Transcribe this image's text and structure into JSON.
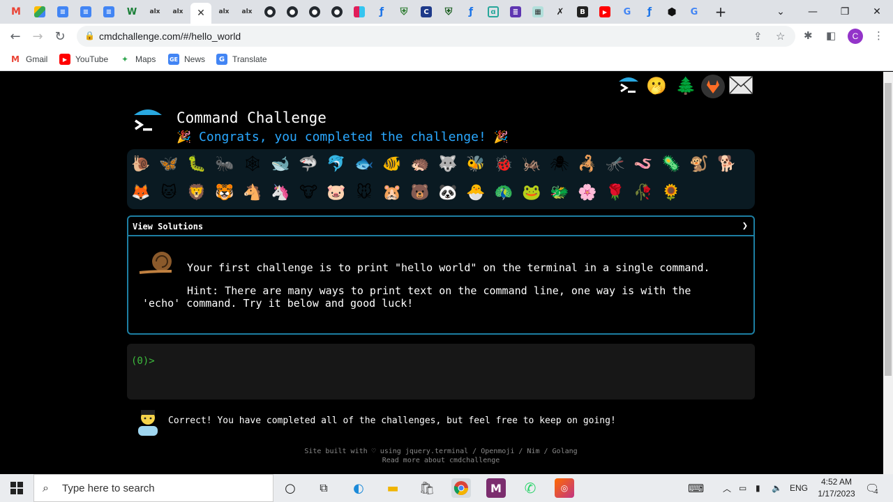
{
  "browser": {
    "tabs_favicons": [
      "gmail-icon",
      "drive-icon",
      "docs-icon",
      "docs-icon",
      "docs-icon",
      "wikipedia-icon",
      "alx-icon",
      "alx-icon",
      "close-icon",
      "alx-icon",
      "alx-icon",
      "github-icon",
      "github-icon",
      "github-icon",
      "github-icon",
      "slack-icon",
      "info-icon",
      "shield-icon",
      "c-icon",
      "shield-icon",
      "info-icon",
      "app-icon",
      "list-icon",
      "map-icon",
      "x-icon",
      "b-icon",
      "youtube-icon",
      "google-icon",
      "info-icon",
      "hex-icon",
      "google-icon"
    ],
    "url": "cmdchallenge.com/#/hello_world",
    "profile_initial": "C",
    "bookmarks": [
      {
        "label": "Gmail",
        "icon": "gmail-icon"
      },
      {
        "label": "YouTube",
        "icon": "youtube-icon"
      },
      {
        "label": "Maps",
        "icon": "maps-icon"
      },
      {
        "label": "News",
        "icon": "news-icon"
      },
      {
        "label": "Translate",
        "icon": "translate-icon"
      }
    ]
  },
  "page": {
    "title": "Command Challenge",
    "subtitle": "Congrats, you completed the challenge!",
    "creatures_row1": [
      "🐌",
      "🦋",
      "🐛",
      "🐜",
      "🕸",
      "🐋",
      "🦈",
      "🐬",
      "🐟",
      "🐠",
      "🦔",
      "🐺",
      "🐝",
      "🐞",
      "🦗",
      "🕷",
      "🦂",
      "🦟",
      "🪱",
      "🦠",
      "🐒",
      "🐕"
    ],
    "creatures_row2": [
      "🦊",
      "🐱",
      "🦁",
      "🐯",
      "🐴",
      "🦄",
      "🐮",
      "🐷",
      "🐭",
      "🐹",
      "🐻",
      "🐼",
      "🐣",
      "🦚",
      "🐸",
      "🐲",
      "🌸",
      "🌹",
      "🥀",
      "🌻"
    ],
    "solutions_label": "View Solutions",
    "challenge_text": "Your first challenge is to print \"hello world\" on the terminal in a single command.",
    "hint_text": "Hint: There are many ways to print text on the command line, one way is with the 'echo' command. Try it below and good luck!",
    "prompt": "(0)>",
    "correct_text": "Correct! You have completed all of the challenges, but feel free to keep on going!",
    "footer_line1": "Site built with ♡ using jquery.terminal / Openmoji / Nim / Golang",
    "footer_line2": "Read more about cmdchallenge"
  },
  "taskbar": {
    "search_placeholder": "Type here to search",
    "language": "ENG",
    "time": "4:52 AM",
    "date": "1/17/2023",
    "notifications": "4"
  }
}
